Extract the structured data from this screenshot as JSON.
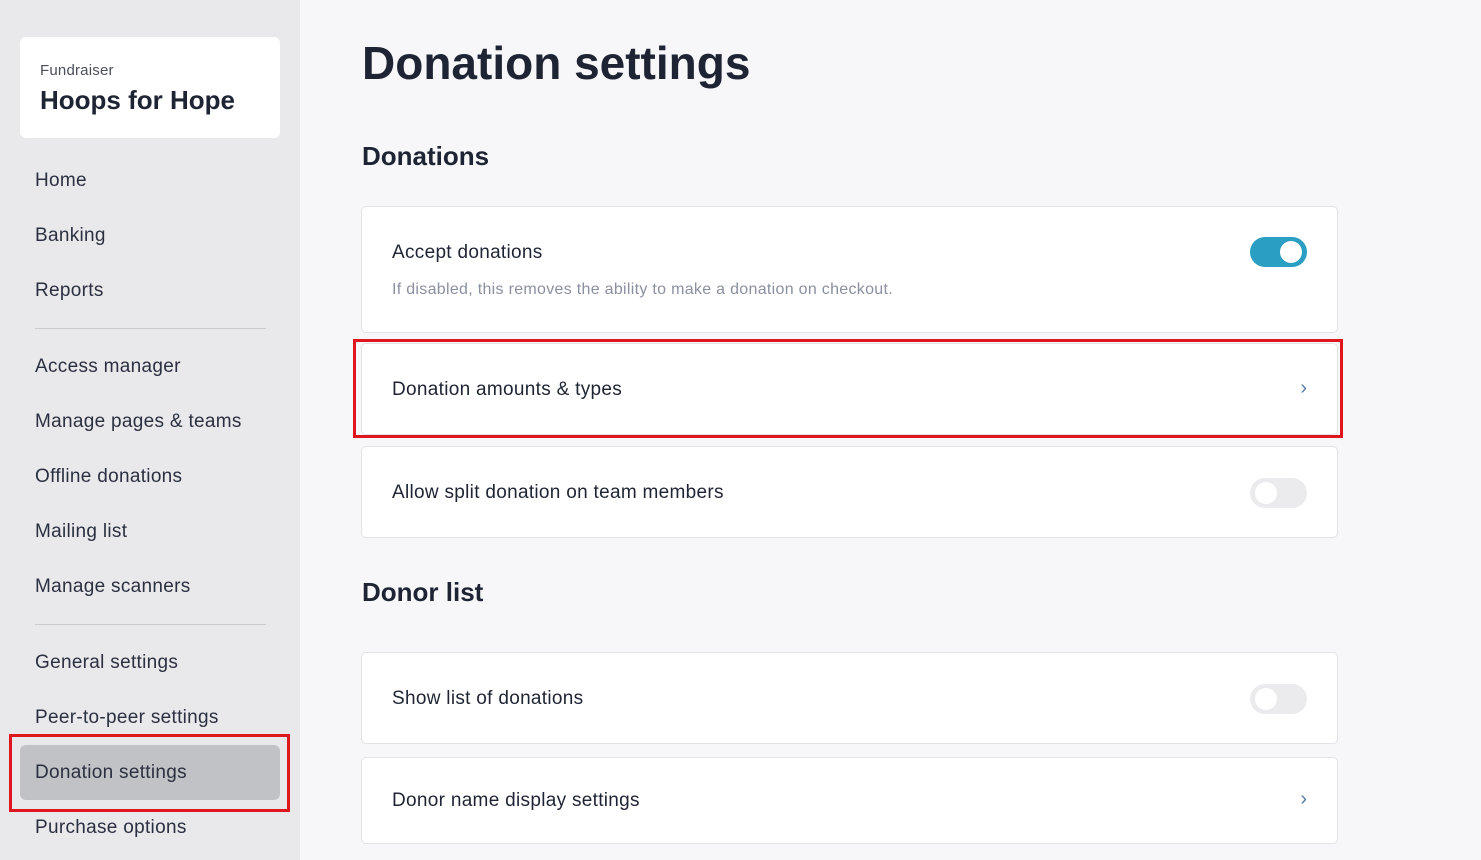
{
  "sidebar": {
    "brand_sub": "Fundraiser",
    "brand_title": "Hoops for Hope",
    "items": [
      {
        "label": "Home"
      },
      {
        "label": "Banking"
      },
      {
        "label": "Reports"
      },
      {
        "label": "Access manager"
      },
      {
        "label": "Manage pages & teams"
      },
      {
        "label": "Offline donations"
      },
      {
        "label": "Mailing list"
      },
      {
        "label": "Manage scanners"
      },
      {
        "label": "General settings"
      },
      {
        "label": "Peer-to-peer settings"
      },
      {
        "label": "Donation settings",
        "active": true
      },
      {
        "label": "Purchase options"
      }
    ]
  },
  "main": {
    "title": "Donation settings",
    "sections": [
      {
        "title": "Donations",
        "rows": [
          {
            "label": "Accept donations",
            "description": "If disabled, this removes the ability to make a donation on checkout.",
            "control": "toggle",
            "value": true
          },
          {
            "label": "Donation amounts & types",
            "control": "chevron"
          },
          {
            "label": "Allow split donation on team members",
            "control": "toggle",
            "value": false
          }
        ]
      },
      {
        "title": "Donor list",
        "rows": [
          {
            "label": "Show list of donations",
            "control": "toggle",
            "value": false
          },
          {
            "label": "Donor name display settings",
            "control": "chevron"
          }
        ]
      }
    ]
  },
  "colors": {
    "accent": "#2a9fc3",
    "highlight": "#e0161f"
  }
}
